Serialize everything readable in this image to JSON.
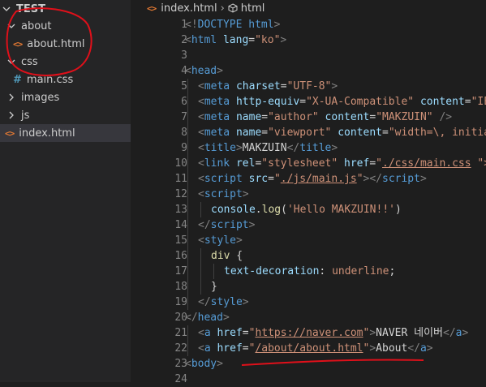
{
  "explorer": {
    "root": "TEST",
    "items": [
      {
        "label": "about",
        "type": "folder",
        "expanded": true
      },
      {
        "label": "about.html",
        "type": "html"
      },
      {
        "label": "css",
        "type": "folder",
        "expanded": true
      },
      {
        "label": "main.css",
        "type": "css"
      },
      {
        "label": "images",
        "type": "folder",
        "expanded": false
      },
      {
        "label": "js",
        "type": "folder",
        "expanded": false
      },
      {
        "label": "index.html",
        "type": "html",
        "selected": true
      }
    ]
  },
  "breadcrumb": {
    "file": "index.html",
    "symbol": "html"
  },
  "code": {
    "line_numbers": [
      "1",
      "2",
      "3",
      "4",
      "5",
      "6",
      "7",
      "8",
      "9",
      "10",
      "11",
      "12",
      "13",
      "14",
      "15",
      "16",
      "17",
      "18",
      "19",
      "20",
      "21",
      "22",
      "23",
      "24"
    ],
    "l1": [
      "<!",
      "DOCTYPE",
      " html",
      ">"
    ],
    "l2": [
      "<",
      "html",
      " lang",
      "=",
      "\"ko\"",
      ">"
    ],
    "l4": [
      "<",
      "head",
      ">"
    ],
    "l5": [
      "<",
      "meta",
      " charset",
      "=",
      "\"UTF-8\"",
      ">"
    ],
    "l6": [
      "<",
      "meta",
      " http-equiv",
      "=",
      "\"X-UA-Compatible\"",
      " content",
      "=",
      "\"IE"
    ],
    "l7": [
      "<",
      "meta",
      " name",
      "=",
      "\"author\"",
      " content",
      "=",
      "\"MAKZUIN\"",
      " />"
    ],
    "l8": [
      "<",
      "meta",
      " name",
      "=",
      "\"viewport\"",
      " content",
      "=",
      "\"width=\\, initia"
    ],
    "l9": [
      "<",
      "title",
      ">",
      "MAKZUIN",
      "</",
      "title",
      ">"
    ],
    "l10": [
      "<",
      "link",
      " rel",
      "=",
      "\"stylesheet\"",
      " href",
      "=",
      "\"",
      "./css/main.css",
      " \">"
    ],
    "l11": [
      "<",
      "script",
      " src",
      "=",
      "\"",
      "./js/main.js",
      "\"",
      ">",
      "</",
      "script",
      ">"
    ],
    "l12": [
      "<",
      "script",
      ">"
    ],
    "l13": [
      "console",
      ".",
      "log",
      "(",
      "'Hello MAKZUIN!!'",
      ")"
    ],
    "l14": [
      "</",
      "script",
      ">"
    ],
    "l15": [
      "<",
      "style",
      ">"
    ],
    "l16": [
      "div",
      " {"
    ],
    "l17": [
      "text-decoration",
      ": ",
      "underline",
      ";"
    ],
    "l18": [
      "}"
    ],
    "l19": [
      "</",
      "style",
      ">"
    ],
    "l20": [
      "</",
      "head",
      ">"
    ],
    "l21": [
      "<",
      "a",
      " href",
      "=",
      "\"",
      "https://naver.com",
      "\"",
      ">",
      "NAVER 네이버",
      "</",
      "a",
      ">"
    ],
    "l22": [
      "<",
      "a",
      " href",
      "=",
      "\"",
      "/about/about.html",
      "\"",
      ">",
      "About",
      "</",
      "a",
      ">"
    ],
    "l23": [
      "<",
      "body",
      ">"
    ]
  },
  "colors": {
    "tag": "#569cd6",
    "attribute": "#9cdcfe",
    "string": "#ce9178",
    "punctuation": "#808080",
    "annotation": "#e0101a"
  }
}
